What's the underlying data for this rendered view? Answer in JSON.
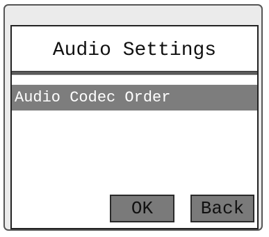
{
  "screen": {
    "title": "Audio Settings"
  },
  "menu": {
    "items": [
      {
        "label": "Audio Codec Order",
        "selected": true
      }
    ]
  },
  "buttons": {
    "ok_label": "OK",
    "back_label": "Back"
  },
  "colors": {
    "device_background": "#ebebeb",
    "screen_background": "#ffffff",
    "selection_highlight": "#7d7d7d",
    "button_fill": "#7a7a7a",
    "item_text": "#ffffff"
  }
}
